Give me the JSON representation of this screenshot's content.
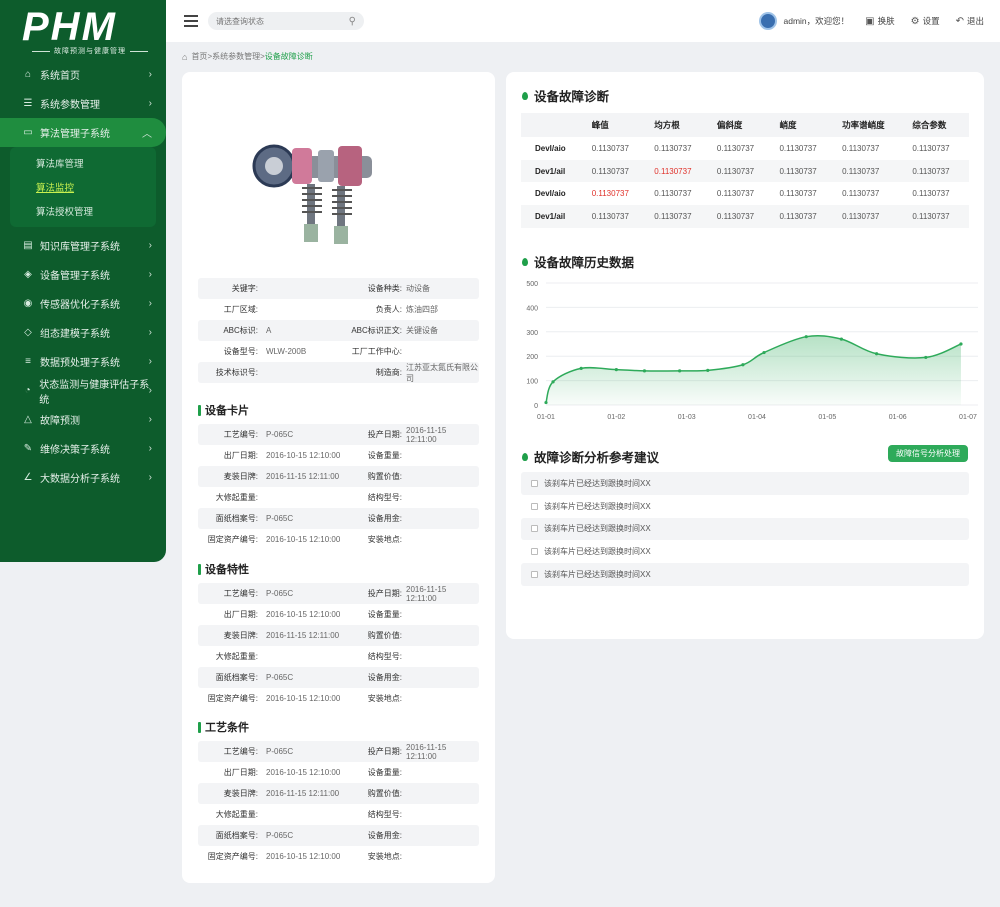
{
  "brand": {
    "logo": "PHM",
    "subtitle": "故障预测与健康管理"
  },
  "sidebar": {
    "items": [
      {
        "icon": "home-icon",
        "label": "系统首页"
      },
      {
        "icon": "sliders-icon",
        "label": "系统参数管理"
      },
      {
        "icon": "monitor-icon",
        "label": "算法管理子系统",
        "active": true,
        "children": [
          {
            "label": "算法库管理"
          },
          {
            "label": "算法监控",
            "current": true
          },
          {
            "label": "算法授权管理"
          }
        ]
      },
      {
        "icon": "book-icon",
        "label": "知识库管理子系统"
      },
      {
        "icon": "layers-icon",
        "label": "设备管理子系统"
      },
      {
        "icon": "signal-icon",
        "label": "传感器优化子系统"
      },
      {
        "icon": "cube-icon",
        "label": "组态建模子系统"
      },
      {
        "icon": "database-icon",
        "label": "数据预处理子系统"
      },
      {
        "icon": "gauge-icon",
        "label": "状态监测与健康评估子系统"
      },
      {
        "icon": "warning-icon",
        "label": "故障预测"
      },
      {
        "icon": "wrench-icon",
        "label": "维修决策子系统"
      },
      {
        "icon": "chart-icon",
        "label": "大数据分析子系统"
      }
    ]
  },
  "header": {
    "search_placeholder": "请选查询状态",
    "user": "admin，欢迎您！",
    "switch_label": "换肤",
    "settings_label": "设置",
    "logout_label": "退出"
  },
  "breadcrumb": {
    "home": "首页",
    "sep1": ">",
    "level1": "系统参数管理",
    "sep2": ">",
    "current": "设备故障诊断"
  },
  "device_info": [
    {
      "k1": "关键字:",
      "v1": "",
      "k2": "设备种类:",
      "v2": "动设备"
    },
    {
      "k1": "工厂区域:",
      "v1": "",
      "k2": "负责人:",
      "v2": "炼油四部"
    },
    {
      "k1": "ABC标识:",
      "v1": "A",
      "k2": "ABC标识正文:",
      "v2": "关键设备"
    },
    {
      "k1": "设备型号:",
      "v1": "WLW-200B",
      "k2": "工厂工作中心:",
      "v2": ""
    },
    {
      "k1": "技术标识号:",
      "v1": "",
      "k2": "制造商:",
      "v2": "江苏亚太氮氏有限公司"
    }
  ],
  "sections": [
    {
      "title": "设备卡片",
      "rows": [
        {
          "k1": "工艺编号:",
          "v1": "P-065C",
          "k2": "投产日期:",
          "v2": "2016-11-15  12:11:00"
        },
        {
          "k1": "出厂日期:",
          "v1": "2016-10-15  12:10:00",
          "k2": "设备重量:",
          "v2": ""
        },
        {
          "k1": "麦装日牌:",
          "v1": "2016-11-15  12:11:00",
          "k2": "购置价值:",
          "v2": ""
        },
        {
          "k1": "大修起重量:",
          "v1": "",
          "k2": "结构型号:",
          "v2": ""
        },
        {
          "k1": "面纸档案号:",
          "v1": "P-065C",
          "k2": "设备用金:",
          "v2": ""
        },
        {
          "k1": "固定资产编号:",
          "v1": "2016-10-15  12:10:00",
          "k2": "安装地点:",
          "v2": ""
        }
      ]
    },
    {
      "title": "设备特性",
      "rows": [
        {
          "k1": "工艺编号:",
          "v1": "P-065C",
          "k2": "投产日期:",
          "v2": "2016-11-15  12:11:00"
        },
        {
          "k1": "出厂日期:",
          "v1": "2016-10-15  12:10:00",
          "k2": "设备重量:",
          "v2": ""
        },
        {
          "k1": "麦装日牌:",
          "v1": "2016-11-15  12:11:00",
          "k2": "购置价值:",
          "v2": ""
        },
        {
          "k1": "大修起重量:",
          "v1": "",
          "k2": "结构型号:",
          "v2": ""
        },
        {
          "k1": "面纸档案号:",
          "v1": "P-065C",
          "k2": "设备用金:",
          "v2": ""
        },
        {
          "k1": "固定资产编号:",
          "v1": "2016-10-15  12:10:00",
          "k2": "安装地点:",
          "v2": ""
        }
      ]
    },
    {
      "title": "工艺条件",
      "rows": [
        {
          "k1": "工艺编号:",
          "v1": "P-065C",
          "k2": "投产日期:",
          "v2": "2016-11-15  12:11:00"
        },
        {
          "k1": "出厂日期:",
          "v1": "2016-10-15  12:10:00",
          "k2": "设备重量:",
          "v2": ""
        },
        {
          "k1": "麦装日牌:",
          "v1": "2016-11-15  12:11:00",
          "k2": "购置价值:",
          "v2": ""
        },
        {
          "k1": "大修起重量:",
          "v1": "",
          "k2": "结构型号:",
          "v2": ""
        },
        {
          "k1": "面纸档案号:",
          "v1": "P-065C",
          "k2": "设备用金:",
          "v2": ""
        },
        {
          "k1": "固定资产编号:",
          "v1": "2016-10-15  12:10:00",
          "k2": "安装地点:",
          "v2": ""
        }
      ]
    }
  ],
  "diagnosis": {
    "title": "设备故障诊断",
    "headers": [
      "",
      "峰值",
      "均方根",
      "偏斜度",
      "峭度",
      "功率谱峭度",
      "综合参数"
    ],
    "rows": [
      {
        "name": "Devl/aio",
        "values": [
          "0.1130737",
          "0.1130737",
          "0.1130737",
          "0.1130737",
          "0.1130737",
          "0.1130737"
        ],
        "red": []
      },
      {
        "name": "Dev1/ail",
        "values": [
          "0.1130737",
          "0.1130737",
          "0.1130737",
          "0.1130737",
          "0.1130737",
          "0.1130737"
        ],
        "red": [
          1
        ]
      },
      {
        "name": "Devl/aio",
        "values": [
          "0.1130737",
          "0.1130737",
          "0.1130737",
          "0.1130737",
          "0.1130737",
          "0.1130737"
        ],
        "red": [
          0
        ]
      },
      {
        "name": "Dev1/ail",
        "values": [
          "0.1130737",
          "0.1130737",
          "0.1130737",
          "0.1130737",
          "0.1130737",
          "0.1130737"
        ],
        "red": []
      }
    ]
  },
  "history": {
    "title": "设备故障历史数据"
  },
  "chart_data": {
    "type": "area",
    "x_ticks": [
      "01-01",
      "01-02",
      "01-03",
      "01-04",
      "01-05",
      "01-06",
      "01-07"
    ],
    "y_ticks": [
      0,
      100,
      200,
      300,
      400,
      500
    ],
    "ylim": [
      0,
      500
    ],
    "x": [
      1.0,
      1.1,
      1.5,
      2.0,
      2.4,
      2.9,
      3.3,
      3.8,
      4.1,
      4.7,
      5.2,
      5.7,
      6.4,
      6.9
    ],
    "values": [
      10,
      95,
      150,
      145,
      140,
      140,
      142,
      165,
      215,
      280,
      270,
      210,
      195,
      250
    ],
    "line_color": "#2eaa5a",
    "fill_color": "#d9f2e1",
    "grid": true
  },
  "suggestions": {
    "title": "故障诊断分析参考建议",
    "button": "故障信号分析处理",
    "items": [
      "该刹车片已经达到跟换时间XX",
      "该刹车片已经达到跟换时间XX",
      "该刹车片已经达到跟换时间XX",
      "该刹车片已经达到跟换时间XX",
      "该刹车片已经达到跟换时间XX"
    ]
  },
  "colors": {
    "accent": "#1f9f4a",
    "sidebar": "#0d5c2c",
    "alert": "#e0322b"
  }
}
